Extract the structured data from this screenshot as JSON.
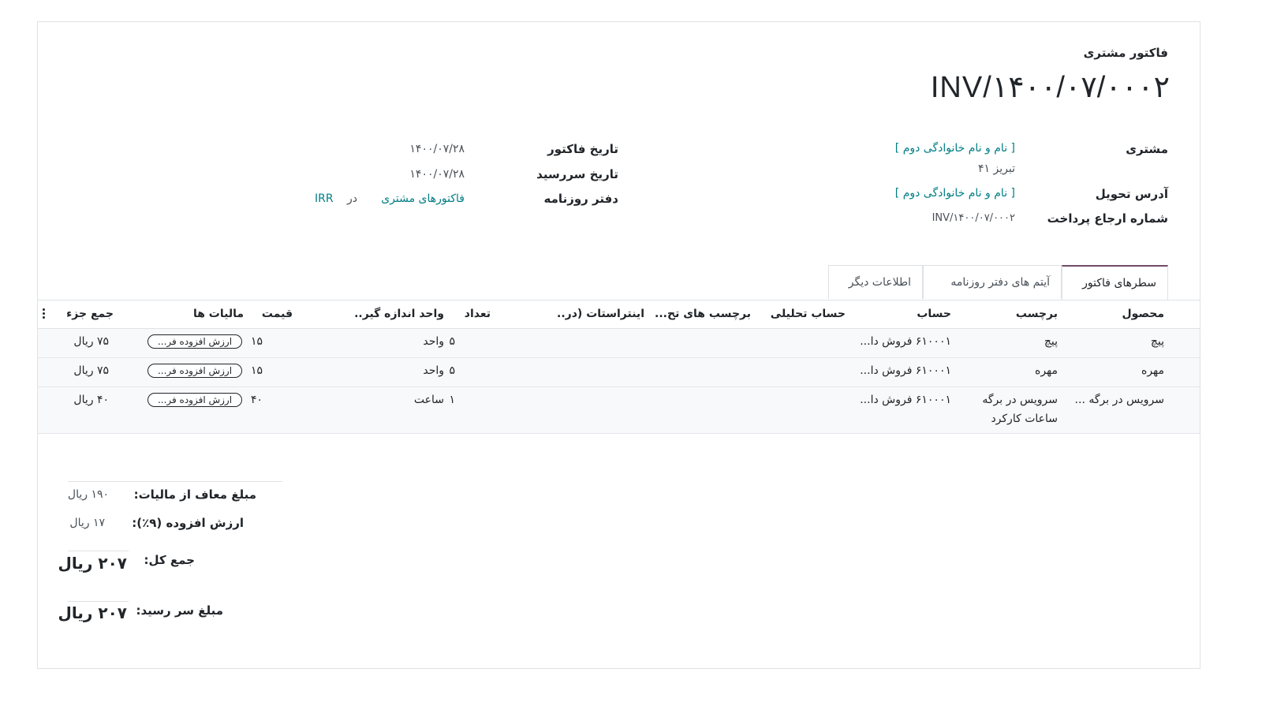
{
  "header": {
    "doc_type": "فاکتور مشتری",
    "doc_number": "INV/۱۴۰۰/۰۷/۰۰۰۲"
  },
  "partner": {
    "customer_label": "مشتری",
    "customer_value": "[ نام و نام خانوادگی دوم ]",
    "customer_address": "تبریز ۴۱",
    "delivery_label": "آدرس تحویل",
    "delivery_value": "[ نام و نام خانوادگی دوم ]",
    "payment_ref_label": "شماره ارجاع پرداخت",
    "payment_ref_value": "INV/۱۴۰۰/۰۷/۰۰۰۲"
  },
  "dates": {
    "invoice_date_label": "تاریخ فاکتور",
    "invoice_date_value": "۱۴۰۰/۰۷/۲۸",
    "due_date_label": "تاریخ سررسید",
    "due_date_value": "۱۴۰۰/۰۷/۲۸",
    "journal_label": "دفتر روزنامه",
    "journal_value": "فاکتورهای مشتری",
    "journal_in": "در",
    "currency": "IRR"
  },
  "tabs": [
    {
      "label": "سطرهای فاکتور",
      "active": true
    },
    {
      "label": "آیتم های دفتر روزنامه",
      "active": false
    },
    {
      "label": "اطلاعات دیگر",
      "active": false
    }
  ],
  "table": {
    "columns": {
      "product": "محصول",
      "label": "برچسب",
      "account": "حساب",
      "analytic": "حساب تحلیلی",
      "analytic_tags": "برچسب های تح...",
      "intrastat": "اینتراستات (در...",
      "quantity": "تعداد",
      "uom": "واحد اندازه گیر...",
      "price": "قیمت",
      "taxes": "مالیات ها",
      "subtotal": "جمع جزء"
    },
    "rows": [
      {
        "product": "پیچ",
        "label": "پیچ",
        "label2": "",
        "account": "۶۱۰۰۰۱ فروش دا...",
        "quantity": "۵",
        "uom": "واحد",
        "price": "۱۵",
        "tax": "ارزش افزوده فر...",
        "subtotal": "۷۵ ریال"
      },
      {
        "product": "مهره",
        "label": "مهره",
        "label2": "",
        "account": "۶۱۰۰۰۱ فروش دا...",
        "quantity": "۵",
        "uom": "واحد",
        "price": "۱۵",
        "tax": "ارزش افزوده فر...",
        "subtotal": "۷۵ ریال"
      },
      {
        "product": "سرویس در برگه ...",
        "label": "سرویس در برگه",
        "label2": "ساعات کارکرد",
        "account": "۶۱۰۰۰۱ فروش دا...",
        "quantity": "۱",
        "uom": "ساعت",
        "price": "۴۰",
        "tax": "ارزش افزوده فر...",
        "subtotal": "۴۰ ریال"
      }
    ]
  },
  "totals": {
    "untaxed_label": "مبلغ معاف از مالیات:",
    "untaxed_value": "۱۹۰ ریال",
    "vat_label": "ارزش افزوده (۹٪):",
    "vat_value": "۱۷ ریال",
    "total_label": "جمع کل:",
    "total_value": "۲۰۷ ریال",
    "due_label": "مبلغ سر رسید:",
    "due_value": "۲۰۷ ریال"
  }
}
